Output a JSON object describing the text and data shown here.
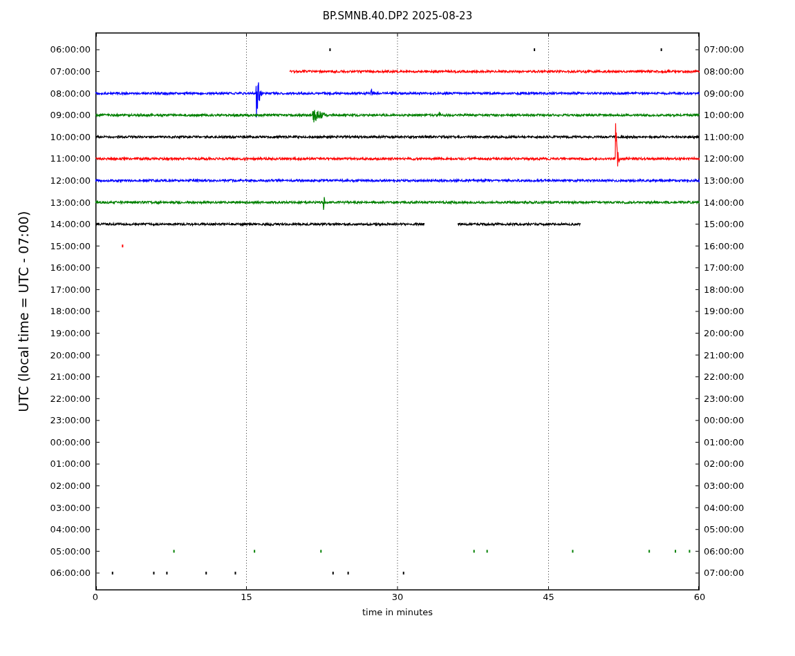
{
  "title": "BP.SMNB.40.DP2 2025-08-23",
  "y_axis": {
    "label": "UTC (local time = UTC - 07:00)"
  },
  "x_axis": {
    "label": "time in minutes",
    "ticks": [
      "0",
      "15",
      "30",
      "45",
      "60"
    ]
  },
  "left_ticks": [
    "06:00:00",
    "07:00:00",
    "08:00:00",
    "09:00:00",
    "10:00:00",
    "11:00:00",
    "12:00:00",
    "13:00:00",
    "14:00:00",
    "15:00:00",
    "16:00:00",
    "17:00:00",
    "18:00:00",
    "19:00:00",
    "20:00:00",
    "21:00:00",
    "22:00:00",
    "23:00:00",
    "00:00:00",
    "01:00:00",
    "02:00:00",
    "03:00:00",
    "04:00:00",
    "05:00:00",
    "06:00:00"
  ],
  "right_ticks": [
    "07:00:00",
    "08:00:00",
    "09:00:00",
    "10:00:00",
    "11:00:00",
    "12:00:00",
    "13:00:00",
    "14:00:00",
    "15:00:00",
    "16:00:00",
    "17:00:00",
    "18:00:00",
    "19:00:00",
    "20:00:00",
    "21:00:00",
    "22:00:00",
    "23:00:00",
    "00:00:00",
    "01:00:00",
    "02:00:00",
    "03:00:00",
    "04:00:00",
    "05:00:00",
    "06:00:00",
    "07:00:00"
  ]
}
